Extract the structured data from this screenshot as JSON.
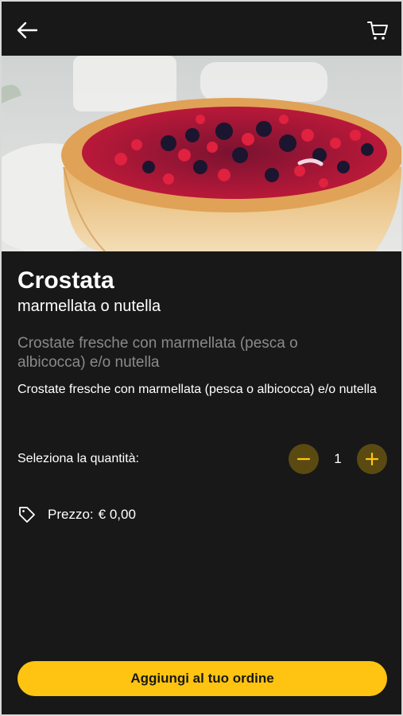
{
  "header": {
    "back_icon": "arrow-left-icon",
    "cart_icon": "shopping-cart-icon"
  },
  "product": {
    "image": "tart-with-red-berries",
    "name": "Crostata",
    "subtitle": "marmellata o nutella",
    "description_preview": "Crostate fresche con marmellata (pesca o albicocca) e/o nutella",
    "description": "Crostate fresche con marmellata (pesca o albicocca) e/o nutella"
  },
  "quantity": {
    "label": "Seleziona la quantità:",
    "value": "1",
    "minus_icon": "minus-icon",
    "plus_icon": "plus-icon"
  },
  "price": {
    "icon": "price-tag-icon",
    "label": "Prezzo:",
    "value": "€ 0,00"
  },
  "cta": {
    "label": "Aggiungi al tuo ordine"
  },
  "colors": {
    "background": "#181818",
    "accent": "#ffc411",
    "accent_dark": "#5a4a12",
    "muted_text": "#8a8a8a"
  }
}
